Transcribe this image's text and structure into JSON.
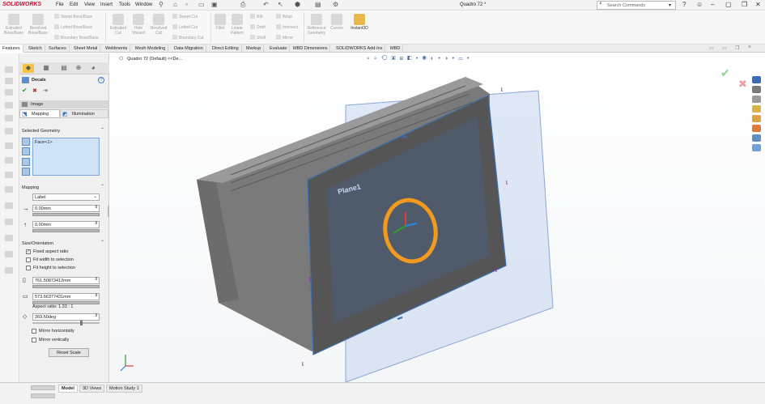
{
  "app": {
    "logo_text": "SOLIDWORKS",
    "document_title": "Quadro 72 *",
    "menu": [
      "File",
      "Edit",
      "View",
      "Insert",
      "Tools",
      "Window"
    ],
    "search_placeholder": "Search Commands",
    "brand_color": "#c8102e"
  },
  "ribbon": {
    "big_buttons": [
      {
        "label": "Extruded Boss/Base"
      },
      {
        "label": "Revolved Boss/Base"
      },
      {
        "label": "Extruded Cut"
      },
      {
        "label": "Hole Wizard"
      },
      {
        "label": "Revolved Cut"
      },
      {
        "label": "Fillet"
      },
      {
        "label": "Linear Pattern"
      },
      {
        "label": "Reference Geometry"
      },
      {
        "label": "Curves"
      },
      {
        "label": "Instant3D"
      }
    ],
    "small_buttons": [
      {
        "label": "Swept Boss/Base"
      },
      {
        "label": "Lofted Boss/Base"
      },
      {
        "label": "Boundary Boss/Base"
      },
      {
        "label": "Swept Cut"
      },
      {
        "label": "Lofted Cut"
      },
      {
        "label": "Boundary Cut"
      },
      {
        "label": "Rib"
      },
      {
        "label": "Draft"
      },
      {
        "label": "Shell"
      },
      {
        "label": "Wrap"
      },
      {
        "label": "Intersect"
      },
      {
        "label": "Mirror"
      }
    ]
  },
  "tabs": [
    "Features",
    "Sketch",
    "Surfaces",
    "Sheet Metal",
    "Weldments",
    "Mesh Modeling",
    "Data Migration",
    "Direct Editing",
    "Markup",
    "Evaluate",
    "MBD Dimensions",
    "SOLIDWORKS Add-Ins",
    "MBD"
  ],
  "property_manager": {
    "title": "Decals",
    "help": "?",
    "ok": "✔",
    "cancel": "✖",
    "pin": "⇥",
    "subtabs": {
      "image": "Image",
      "mapping": "Mapping",
      "illumination": "Illumination"
    },
    "selected_geometry": {
      "header": "Selected Geometry",
      "items": [
        "Face<1>"
      ]
    },
    "mapping": {
      "header": "Mapping",
      "type": "Label",
      "horizontal": "0.00mm",
      "vertical": "0.00mm"
    },
    "size": {
      "header": "Size/Orientation",
      "fixed_aspect": "Fixed aspect ratio",
      "fit_width": "Fit width to selection",
      "fit_height": "Fit height to selection",
      "width": "761.50873412mm",
      "height": "573.66377431mm",
      "aspect": "Aspect ratio: 1.33 : 1",
      "angle": "269.50deg",
      "mirror_h": "Mirror horizontally",
      "mirror_v": "Mirror vertically",
      "reset": "Reset Scale",
      "fixed_aspect_checked": true
    }
  },
  "viewport": {
    "breadcrumb": "Quadro 72 (Default) <<De...",
    "plane_label": "Plane1",
    "accent_orange": "#f39a1e"
  },
  "bottom_tabs": [
    "Model",
    "3D Views",
    "Motion Study 1"
  ],
  "icons": {
    "search": "search-icon",
    "help": "help-icon",
    "user": "user-icon",
    "minimize": "minimize-icon",
    "restore": "restore-icon",
    "close": "close-icon"
  }
}
